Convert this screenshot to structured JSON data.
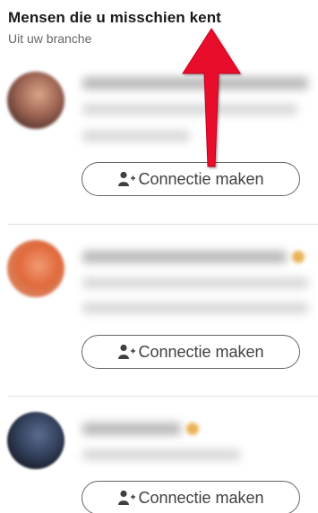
{
  "section": {
    "title": "Mensen die u misschien kent",
    "subtitle": "Uit uw branche"
  },
  "people": [
    {
      "connect_label": "Connectie maken"
    },
    {
      "connect_label": "Connectie maken"
    },
    {
      "connect_label": "Connectie maken"
    }
  ],
  "icons": {
    "connect": "add-person-icon",
    "annotation": "red-arrow-up-icon"
  },
  "colors": {
    "annotation_arrow": "#e8102a",
    "button_border": "#666666",
    "badge": "#e8b357"
  }
}
